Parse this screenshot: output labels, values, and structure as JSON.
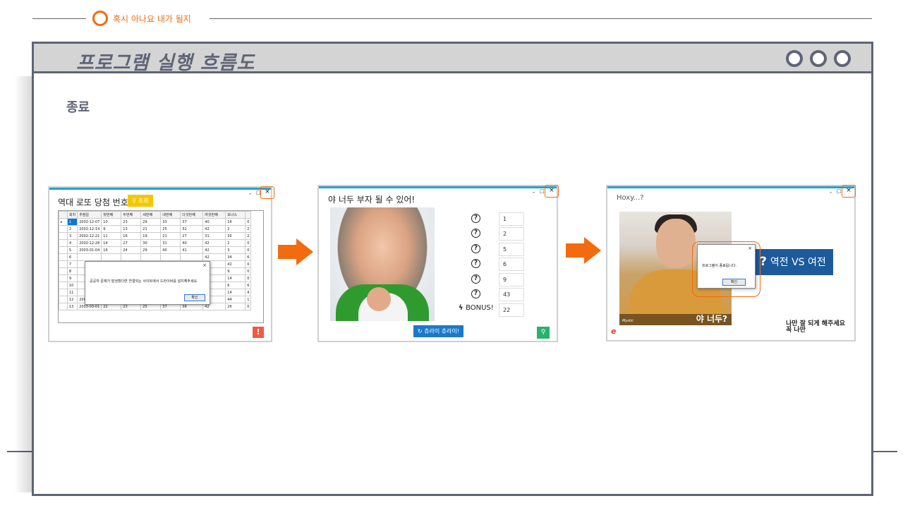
{
  "header": {
    "title": "혹시 아나요 내가 될지"
  },
  "slide": {
    "title": "프로그램 실행 흐름도",
    "section": "종료"
  },
  "colors": {
    "accent": "#f26b0f",
    "frame": "#5f6476",
    "header_bar": "#d4d4d4"
  },
  "window1": {
    "title": "역대 로또 당첨 번호",
    "search_button": "조회",
    "close": "×",
    "minimize": "-",
    "maximize": "□",
    "columns": [
      "회차",
      "추첨일",
      "첫번째",
      "두번째",
      "세번째",
      "네번째",
      "다섯번째",
      "여섯번째",
      "보너스",
      ""
    ],
    "rows": [
      [
        "1",
        "2002-12-07",
        "10",
        "23",
        "29",
        "33",
        "37",
        "40",
        "16",
        "0"
      ],
      [
        "2",
        "2002-12-14",
        "9",
        "13",
        "21",
        "25",
        "32",
        "42",
        "2",
        "2"
      ],
      [
        "3",
        "2002-12-21",
        "11",
        "16",
        "19",
        "21",
        "27",
        "31",
        "30",
        "2"
      ],
      [
        "4",
        "2002-12-28",
        "14",
        "27",
        "30",
        "31",
        "40",
        "42",
        "2",
        "0"
      ],
      [
        "5",
        "2003-01-04",
        "16",
        "24",
        "29",
        "40",
        "41",
        "42",
        "3",
        "0"
      ],
      [
        "6",
        "",
        "",
        "",
        "",
        "",
        "",
        "42",
        "34",
        "6"
      ],
      [
        "7",
        "",
        "",
        "",
        "",
        "",
        "",
        "40",
        "42",
        "0"
      ],
      [
        "8",
        "",
        "",
        "",
        "",
        "",
        "",
        "39",
        "9",
        "0"
      ],
      [
        "9",
        "",
        "",
        "",
        "",
        "",
        "",
        "39",
        "14",
        "0"
      ],
      [
        "10",
        "",
        "",
        "",
        "",
        "",
        "",
        "44",
        "6",
        "6"
      ],
      [
        "11",
        "",
        "",
        "",
        "",
        "",
        "",
        "42",
        "14",
        "4"
      ],
      [
        "12",
        "2003-02-22",
        "2",
        "11",
        "21",
        "25",
        "39",
        "45",
        "44",
        "1"
      ],
      [
        "13",
        "2003-03-01",
        "22",
        "23",
        "25",
        "37",
        "38",
        "42",
        "26",
        "0"
      ]
    ],
    "dialog_message": "공공자 문제가 발생했다면 연결되는 사이트에서 드라이버를 설치해주세요.",
    "dialog_ok": "확인",
    "dialog_close": "×",
    "alert_icon": "!"
  },
  "window2": {
    "title": "야 너두 부자 될 수 있어!",
    "close": "×",
    "minimize": "-",
    "maximize": "□",
    "numbers": [
      "1",
      "2",
      "5",
      "6",
      "9",
      "43"
    ],
    "question_icon": "?",
    "bonus_label": "BONUS!",
    "bonus_value": "22",
    "draw_button": "츄라이 츄라이!",
    "search_icon": "⚲"
  },
  "window3": {
    "title": "Hoxy...?",
    "close": "×",
    "minimize": "-",
    "maximize": "□",
    "photo_caption": "야 너두?",
    "photo_watermark": "Mystic",
    "dialog_message": "프로그램이 종료됩니다.",
    "dialog_ok": "확인",
    "dialog_close": "×",
    "banner_qmark": "?",
    "banner_text": "역전 VS 여전",
    "footer_line1": "나만 잘 되게 해주세요",
    "footer_line2": "꼭 나만",
    "ie_logo": "e"
  }
}
